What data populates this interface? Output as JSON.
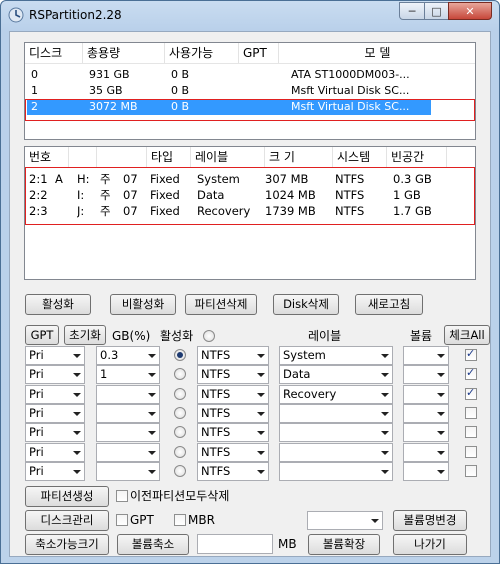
{
  "window": {
    "title": "RSPartition2.28",
    "min": "─",
    "max": "□",
    "close": "✕"
  },
  "disk_list": {
    "headers": [
      "디스크",
      "총용량",
      "사용가능",
      "GPT",
      "모    델"
    ],
    "rows": [
      {
        "disk": "0",
        "total": "931 GB",
        "avail": "0 B",
        "gpt": "",
        "model": "ATA ST1000DM003-..."
      },
      {
        "disk": "1",
        "total": "35 GB",
        "avail": "0 B",
        "gpt": "",
        "model": "Msft Virtual Disk SC..."
      },
      {
        "disk": "2",
        "total": "3072 MB",
        "avail": "0 B",
        "gpt": "",
        "model": "Msft Virtual Disk SC..."
      }
    ]
  },
  "part_list": {
    "headers": [
      "번호",
      "",
      "",
      "타입",
      "레이블",
      "크 기",
      "시스템",
      "빈공간"
    ],
    "rows": [
      {
        "num": "2:1",
        "act": "A",
        "drive": "H:",
        "kind": "주",
        "id": "07",
        "type": "Fixed",
        "label": "System",
        "size": "307 MB",
        "fs": "NTFS",
        "free": "0.3 GB"
      },
      {
        "num": "2:2",
        "act": "",
        "drive": "I:",
        "kind": "주",
        "id": "07",
        "type": "Fixed",
        "label": "Data",
        "size": "1024 MB",
        "fs": "NTFS",
        "free": "1 GB"
      },
      {
        "num": "2:3",
        "act": "",
        "drive": "J:",
        "kind": "주",
        "id": "07",
        "type": "Fixed",
        "label": "Recovery",
        "size": "1739 MB",
        "fs": "NTFS",
        "free": "1.7 GB"
      }
    ]
  },
  "actions": {
    "activate": "활성화",
    "deactivate": "비활성화",
    "delete_part": "파티션삭제",
    "delete_disk": "Disk삭제",
    "refresh": "새로고침"
  },
  "editor": {
    "gpt_btn": "GPT",
    "init_btn": "초기화",
    "gb_label": "GB(%)",
    "active_label": "활성화",
    "label_header": "레이블",
    "volume_header": "볼륨",
    "check_all": "체크All",
    "rows": [
      {
        "type": "Pri",
        "size": "0.3",
        "active": true,
        "fs": "NTFS",
        "label": "System",
        "volume": "",
        "checked": true
      },
      {
        "type": "Pri",
        "size": "1",
        "active": false,
        "fs": "NTFS",
        "label": "Data",
        "volume": "",
        "checked": true
      },
      {
        "type": "Pri",
        "size": "",
        "active": false,
        "fs": "NTFS",
        "label": "Recovery",
        "volume": "",
        "checked": true
      },
      {
        "type": "Pri",
        "size": "",
        "active": false,
        "fs": "NTFS",
        "label": "",
        "volume": "",
        "checked": false
      },
      {
        "type": "Pri",
        "size": "",
        "active": false,
        "fs": "NTFS",
        "label": "",
        "volume": "",
        "checked": false
      },
      {
        "type": "Pri",
        "size": "",
        "active": false,
        "fs": "NTFS",
        "label": "",
        "volume": "",
        "checked": false
      },
      {
        "type": "Pri",
        "size": "",
        "active": false,
        "fs": "NTFS",
        "label": "",
        "volume": "",
        "checked": false
      }
    ]
  },
  "bottom": {
    "create_part": "파티션생성",
    "delete_prev": "이전파티션모두삭제",
    "disk_mgmt": "디스크관리",
    "gpt": "GPT",
    "mbr": "MBR",
    "rename_volume": "볼륨명변경",
    "shrinkable": "축소가능크기",
    "shrink": "볼륨축소",
    "mb": "MB",
    "extend": "볼륨확장",
    "exit": "나가기"
  },
  "colors": {
    "selection": "#3399ff",
    "highlight_box": "#e02020"
  }
}
